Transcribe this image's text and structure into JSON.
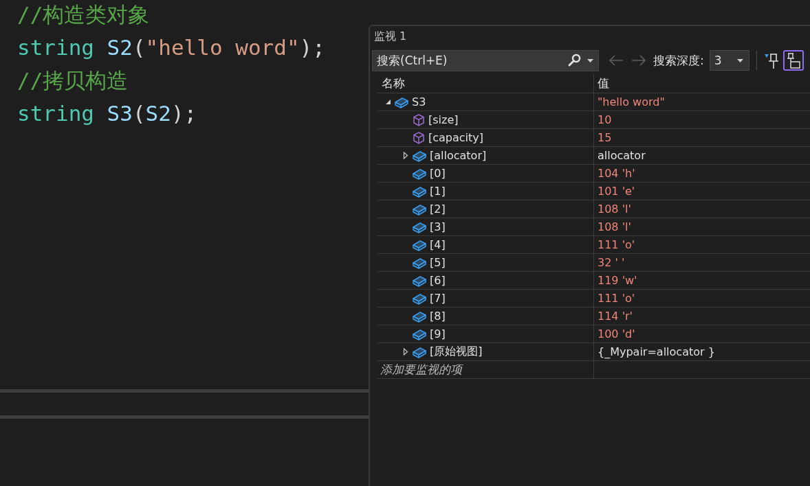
{
  "editor": {
    "lines": [
      [
        {
          "kind": "comment",
          "text": "//构造类对象"
        }
      ],
      [
        {
          "kind": "type",
          "text": "string"
        },
        {
          "kind": "ident",
          "text": "S2"
        },
        {
          "kind": "punct",
          "text": "("
        },
        {
          "kind": "string",
          "text": "\"hello word\""
        },
        {
          "kind": "punct",
          "text": ");"
        }
      ],
      [
        {
          "kind": "comment",
          "text": "//拷贝构造"
        }
      ],
      [
        {
          "kind": "type",
          "text": "string"
        },
        {
          "kind": "ident",
          "text": "S3"
        },
        {
          "kind": "punct",
          "text": "("
        },
        {
          "kind": "ident",
          "text": "S2"
        },
        {
          "kind": "punct",
          "text": ");"
        }
      ]
    ]
  },
  "watch": {
    "title": "监视 1",
    "search": {
      "placeholder": "搜索(Ctrl+E)"
    },
    "depth_label": "搜索深度:",
    "depth_value": "3",
    "columns": [
      "名称",
      "值"
    ],
    "rows": [
      {
        "name": "S3",
        "value": "\"hello word\"",
        "kind": "object",
        "changed": true,
        "expanded": true,
        "children": [
          {
            "name": "[size]",
            "value": "10",
            "kind": "field",
            "changed": true
          },
          {
            "name": "[capacity]",
            "value": "15",
            "kind": "field",
            "changed": true
          },
          {
            "name": "[allocator]",
            "value": "allocator",
            "kind": "object",
            "changed": false,
            "expanded": false
          },
          {
            "name": "[0]",
            "value": "104 'h'",
            "kind": "object",
            "changed": true
          },
          {
            "name": "[1]",
            "value": "101 'e'",
            "kind": "object",
            "changed": true
          },
          {
            "name": "[2]",
            "value": "108 'l'",
            "kind": "object",
            "changed": true
          },
          {
            "name": "[3]",
            "value": "108 'l'",
            "kind": "object",
            "changed": true
          },
          {
            "name": "[4]",
            "value": "111 'o'",
            "kind": "object",
            "changed": true
          },
          {
            "name": "[5]",
            "value": "32 ' '",
            "kind": "object",
            "changed": true
          },
          {
            "name": "[6]",
            "value": "119 'w'",
            "kind": "object",
            "changed": true
          },
          {
            "name": "[7]",
            "value": "111 'o'",
            "kind": "object",
            "changed": true
          },
          {
            "name": "[8]",
            "value": "114 'r'",
            "kind": "object",
            "changed": true
          },
          {
            "name": "[9]",
            "value": "100 'd'",
            "kind": "object",
            "changed": true
          },
          {
            "name": "[原始视图]",
            "value": "{_Mypair=allocator }",
            "kind": "object",
            "changed": false,
            "expanded": false
          }
        ]
      }
    ],
    "add_item_placeholder": "添加要监视的项"
  }
}
